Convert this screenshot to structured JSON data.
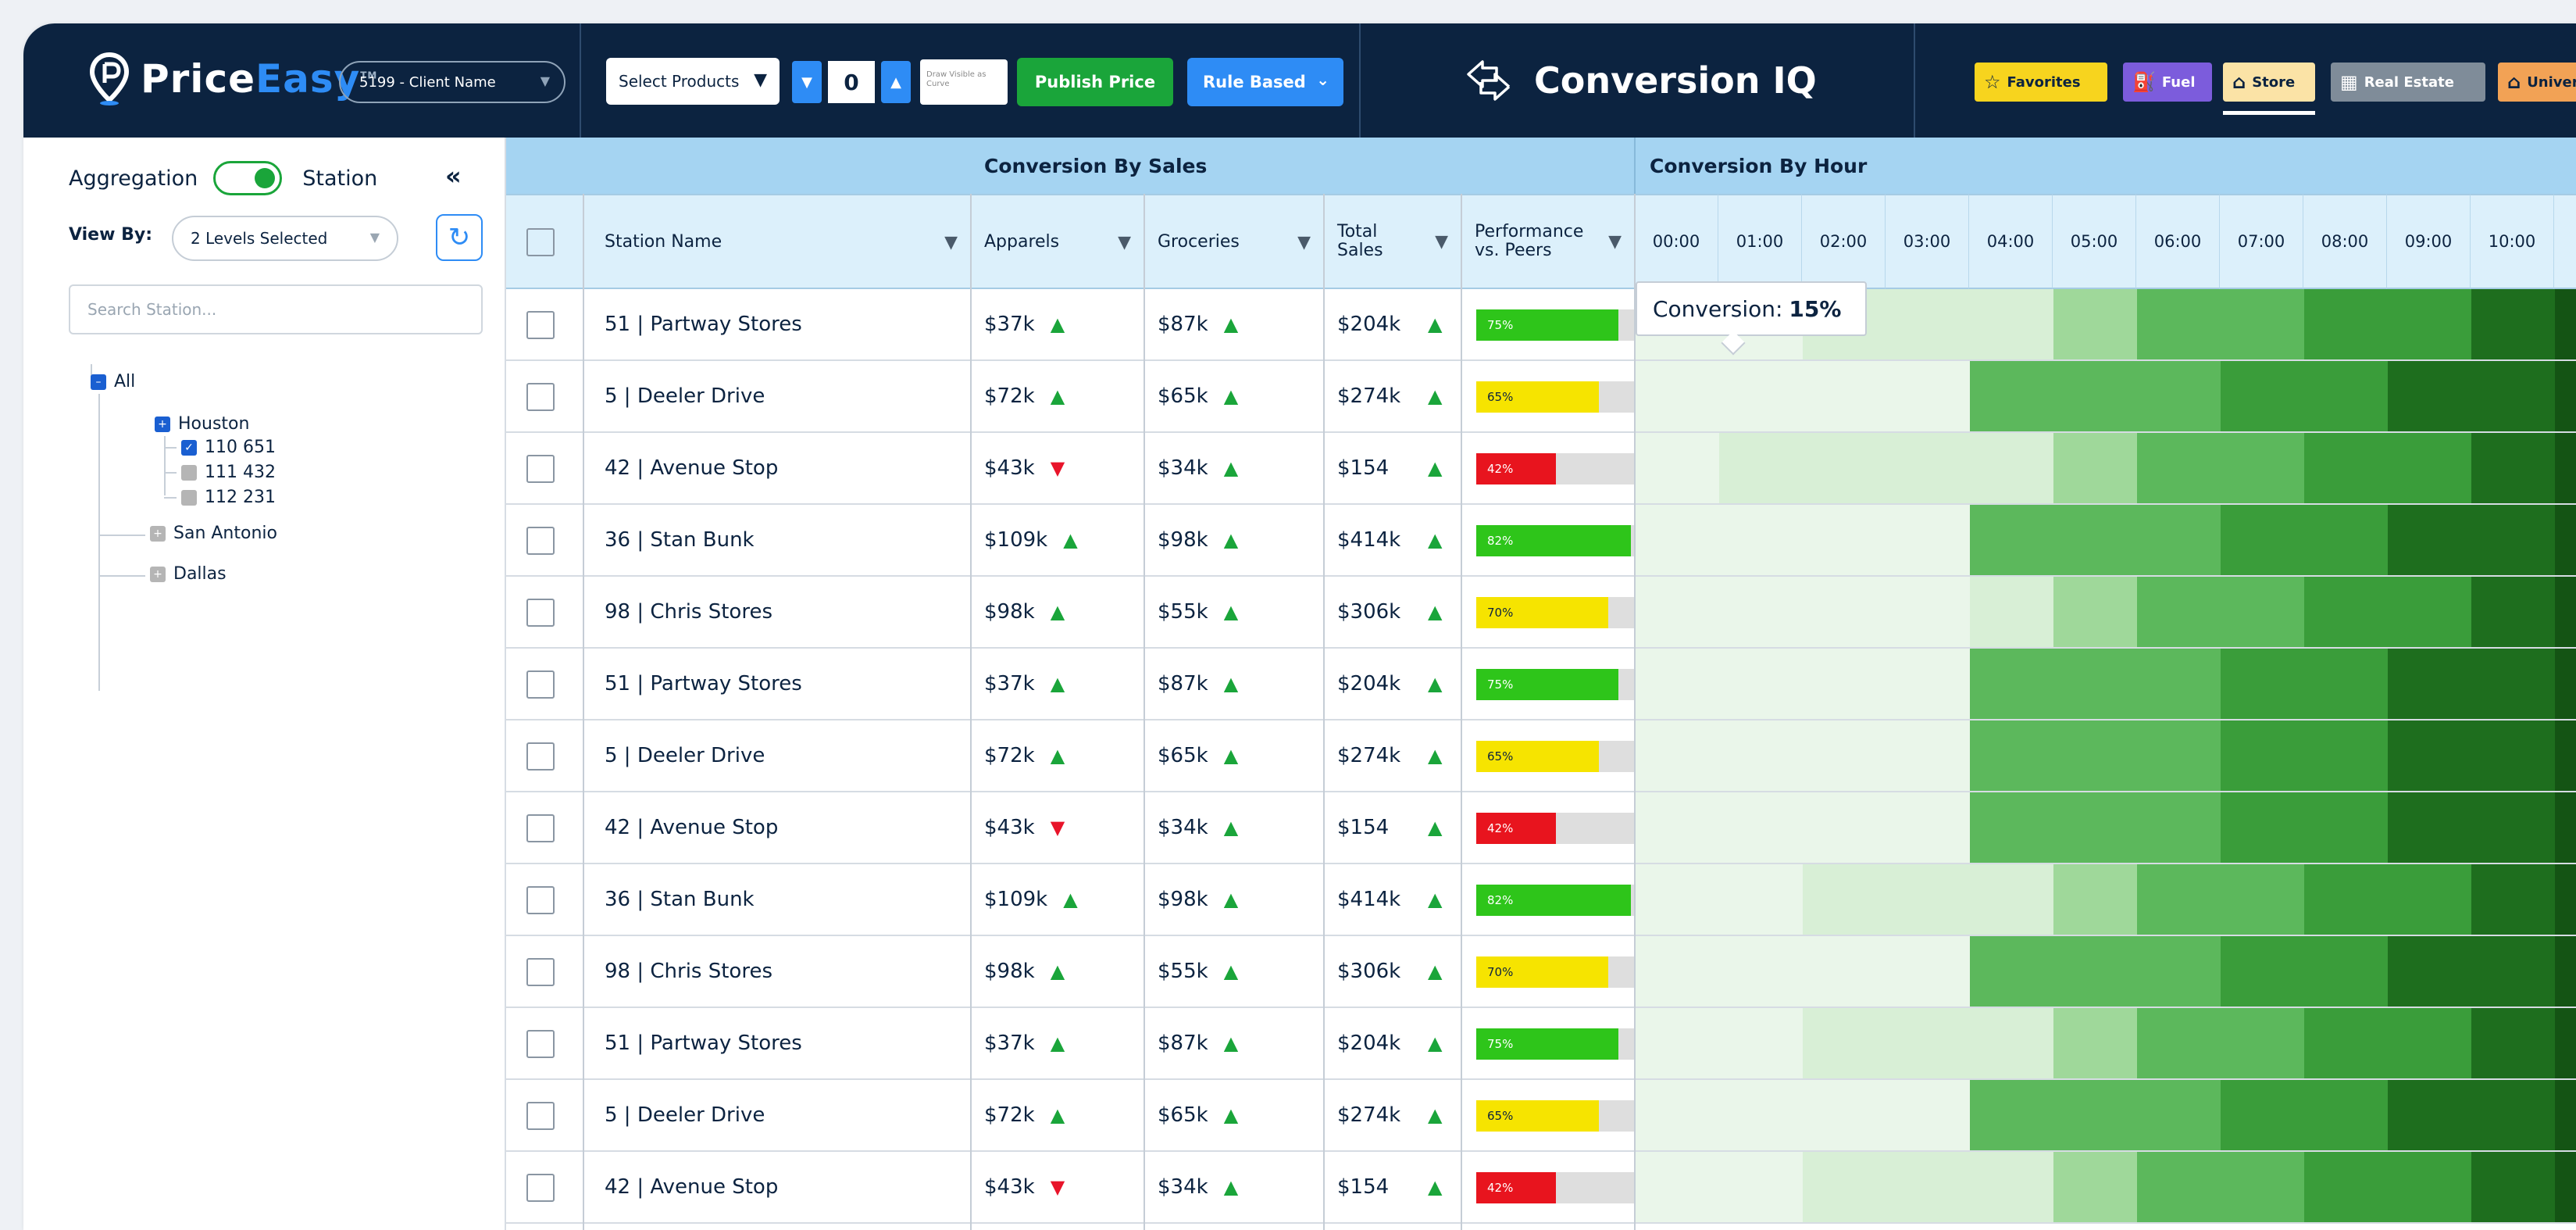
{
  "header": {
    "logo_text_a": "Price",
    "logo_text_b": "Easy",
    "logo_tm": "TM",
    "client_select": "5199 - Client Name",
    "select_products": "Select Products",
    "stepper_value": "0",
    "tiny_text": "Draw Visible as Curve",
    "publish_button": "Publish Price",
    "rule_button": "Rule Based",
    "app_title": "Conversion IQ",
    "tags": {
      "favorites": "Favorites",
      "fuel": "Fuel",
      "store": "Store",
      "real_estate": "Real Estate",
      "universal": "Univers"
    }
  },
  "sidebar": {
    "aggregation_label": "Aggregation",
    "station_label": "Station",
    "collapse_glyph": "«",
    "view_by_label": "View By:",
    "levels_selected": "2 Levels Selected",
    "search_placeholder": "Search Station...",
    "tree": {
      "all": "All",
      "houston": "Houston",
      "h1": "110 651",
      "h2": "111 432",
      "h3": "112 231",
      "san_antonio": "San Antonio",
      "dallas": "Dallas"
    }
  },
  "table": {
    "group_sales": "Conversion By Sales",
    "group_hour": "Conversion By Hour",
    "col_station": "Station Name",
    "col_apparels": "Apparels",
    "col_groceries": "Groceries",
    "col_total_1": "Total",
    "col_total_2": "Sales",
    "col_perf_1": "Performance",
    "col_perf_2": "vs. Peers",
    "hours": [
      "00:00",
      "01:00",
      "02:00",
      "03:00",
      "04:00",
      "05:00",
      "06:00",
      "07:00",
      "08:00",
      "09:00",
      "10:00"
    ],
    "tooltip_label": "Conversion:",
    "tooltip_value": "15%",
    "rows": [
      {
        "station": "51 | Partway Stores",
        "apparels": "$37k",
        "app_trend": "up",
        "groceries": "$87k",
        "total": "$204k",
        "perf": 75,
        "perf_label": "75%"
      },
      {
        "station": "5 | Deeler Drive",
        "apparels": "$72k",
        "app_trend": "up",
        "groceries": "$65k",
        "total": "$274k",
        "perf": 65,
        "perf_label": "65%"
      },
      {
        "station": "42 | Avenue Stop",
        "apparels": "$43k",
        "app_trend": "down",
        "groceries": "$34k",
        "total": "$154",
        "perf": 42,
        "perf_label": "42%"
      },
      {
        "station": "36 | Stan Bunk",
        "apparels": "$109k",
        "app_trend": "up",
        "groceries": "$98k",
        "total": "$414k",
        "perf": 82,
        "perf_label": "82%"
      },
      {
        "station": "98 | Chris Stores",
        "apparels": "$98k",
        "app_trend": "up",
        "groceries": "$55k",
        "total": "$306k",
        "perf": 70,
        "perf_label": "70%"
      },
      {
        "station": "51 | Partway Stores",
        "apparels": "$37k",
        "app_trend": "up",
        "groceries": "$87k",
        "total": "$204k",
        "perf": 75,
        "perf_label": "75%"
      },
      {
        "station": "5 | Deeler Drive",
        "apparels": "$72k",
        "app_trend": "up",
        "groceries": "$65k",
        "total": "$274k",
        "perf": 65,
        "perf_label": "65%"
      },
      {
        "station": "42 | Avenue Stop",
        "apparels": "$43k",
        "app_trend": "down",
        "groceries": "$34k",
        "total": "$154",
        "perf": 42,
        "perf_label": "42%"
      },
      {
        "station": "36 | Stan Bunk",
        "apparels": "$109k",
        "app_trend": "up",
        "groceries": "$98k",
        "total": "$414k",
        "perf": 82,
        "perf_label": "82%"
      },
      {
        "station": "98 | Chris Stores",
        "apparels": "$98k",
        "app_trend": "up",
        "groceries": "$55k",
        "total": "$306k",
        "perf": 70,
        "perf_label": "70%"
      },
      {
        "station": "51 | Partway Stores",
        "apparels": "$37k",
        "app_trend": "up",
        "groceries": "$87k",
        "total": "$204k",
        "perf": 75,
        "perf_label": "75%"
      },
      {
        "station": "5 | Deeler Drive",
        "apparels": "$72k",
        "app_trend": "up",
        "groceries": "$65k",
        "total": "$274k",
        "perf": 65,
        "perf_label": "65%"
      },
      {
        "station": "42 | Avenue Stop",
        "apparels": "$43k",
        "app_trend": "down",
        "groceries": "$34k",
        "total": "$154",
        "perf": 42,
        "perf_label": "42%"
      }
    ]
  },
  "colors": {
    "navy": "#0c2340",
    "blue": "#2e8cf5",
    "green": "#1aa53a",
    "perf_green": "#2ec51a",
    "perf_yellow": "#f6e400",
    "perf_red": "#e8141e",
    "heat": [
      "#eaf6ea",
      "#d8efd6",
      "#9fd89a",
      "#5cb85c",
      "#3a9d3a",
      "#1e6e1e",
      "#145414"
    ]
  }
}
